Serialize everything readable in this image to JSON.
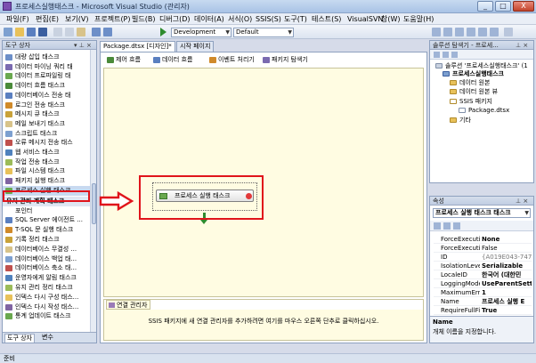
{
  "window": {
    "title": "프로세스실행태스크 - Microsoft Visual Studio (관리자)",
    "minimize": "_",
    "maximize": "□",
    "close": "X"
  },
  "menu": [
    "파일(F)",
    "편집(E)",
    "보기(V)",
    "프로젝트(P)",
    "빌드(B)",
    "디버그(D)",
    "데이터(A)",
    "서식(O)",
    "SSIS(S)",
    "도구(T)",
    "테스트(S)",
    "VisualSVN",
    "창(W)",
    "도움말(H)"
  ],
  "toolbar": {
    "config": "Development",
    "platform": "Default"
  },
  "toolbox": {
    "header": "도구 상자",
    "items": [
      "대량 삽입 태스크",
      "데이터 마이닝 쿼리 태",
      "데이터 프로파일링 태",
      "데이터 흐름 태스크",
      "데이터베이스 전송 태",
      "로그인 전송 태스크",
      "메시지 큐 태스크",
      "메일 보내기 태스크",
      "스크립트 태스크",
      "오류 메시지 전송 태스",
      "웹 서비스 태스크",
      "작업 전송 태스크",
      "파일 시스템 태스크",
      "패키지 실행 태스크",
      "프로세스 실행 태스크"
    ],
    "section": "유지 관리 계획 태스크",
    "maint_items": [
      "포인터",
      "SQL Server 에이전트 ...",
      "T-SQL 문 실행 태스크",
      "기록 정리 태스크",
      "데이터베이스 무결성 ...",
      "데이터베이스 백업 태...",
      "데이터베이스 축소 태...",
      "운영자에게 알림 태스크",
      "유지 관리 정리 태스크",
      "인덱스 다시 구성 태스...",
      "인덱스 다시 작성 태스...",
      "통계 업데이트 태스크"
    ],
    "bottom_tabs": [
      "도구 상자",
      "변수"
    ]
  },
  "document": {
    "tabs": [
      "Package.dtsx [디자인]*",
      "시작 페이지"
    ],
    "subtabs": [
      "제어 흐름",
      "데이터 흐름",
      "이벤트 처리기",
      "패키지 탐색기"
    ],
    "task_label": "프로세스 실행 태스크",
    "conn_header": "연결 관리자",
    "conn_hint": "SSIS 패키지에 새 연결 관리자를 추가하려면 여기를 마우스 오른쪽 단추로 클릭하십시오."
  },
  "solution": {
    "header": "솔루션 탐색기 - 프로세...",
    "tree": [
      "솔루션 '프로세스실행태스크' (1",
      "프로세스실행태스크",
      "데이터 원본",
      "데이터 원본 뷰",
      "SSIS 패키지",
      "Package.dtsx",
      "기타"
    ]
  },
  "properties": {
    "header": "속성",
    "object": "프로세스 실행 태스크 태스크",
    "rows": [
      {
        "name": "ForceExecution",
        "value": "None"
      },
      {
        "name": "ForceExecution",
        "value": "False"
      },
      {
        "name": "ID",
        "value": "{A019E043-747"
      },
      {
        "name": "IsolationLevel",
        "value": "Serializable"
      },
      {
        "name": "LocaleID",
        "value": "한국어 (대한민"
      },
      {
        "name": "LoggingMode",
        "value": "UseParentSett"
      },
      {
        "name": "MaximumErro",
        "value": "1"
      },
      {
        "name": "Name",
        "value": "프로세스 실행 E"
      },
      {
        "name": "RequireFullFile",
        "value": "True"
      }
    ],
    "desc_title": "Name",
    "desc": "개체 이름을 지정합니다."
  },
  "status": "준비",
  "colors": {
    "highlight": "#e0141b",
    "arrow": "#e0141b"
  }
}
